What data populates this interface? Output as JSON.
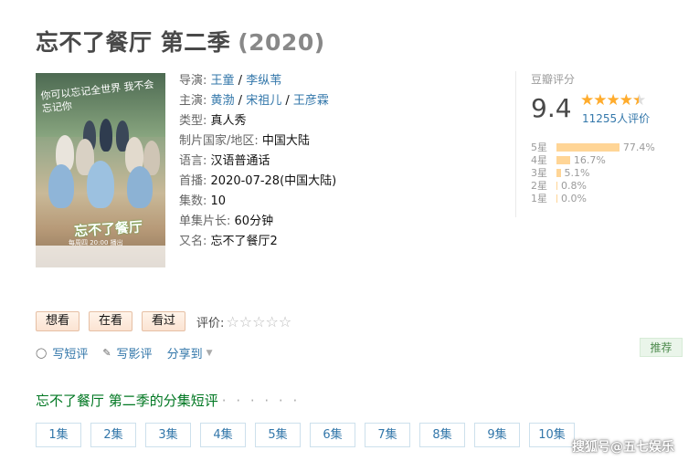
{
  "movie": {
    "title": "忘不了餐厅 第二季",
    "year": "(2020)"
  },
  "poster": {
    "tagline": "你可以忘记全世界 我不会忘记你",
    "logo": "忘不了餐厅",
    "date_text": "每周四 20:00 播出"
  },
  "info": {
    "director_label": "导演:",
    "directors": [
      "王童",
      "李纵苇"
    ],
    "cast_label": "主演:",
    "cast": [
      "黄渤",
      "宋祖儿",
      "王彦霖"
    ],
    "sep": " / ",
    "genre_label": "类型:",
    "genre": "真人秀",
    "country_label": "制片国家/地区:",
    "country": "中国大陆",
    "language_label": "语言:",
    "language": "汉语普通话",
    "premiere_label": "首播:",
    "premiere": "2020-07-28(中国大陆)",
    "episodes_label": "集数:",
    "episodes": "10",
    "runtime_label": "单集片长:",
    "runtime": "60分钟",
    "aka_label": "又名:",
    "aka": "忘不了餐厅2"
  },
  "rating": {
    "label": "豆瓣评分",
    "score": "9.4",
    "count": "11255人评价",
    "stars_value": 4.5,
    "distribution": [
      {
        "label": "5星",
        "percent": "77.4%",
        "value": 77.4
      },
      {
        "label": "4星",
        "percent": "16.7%",
        "value": 16.7
      },
      {
        "label": "3星",
        "percent": "5.1%",
        "value": 5.1
      },
      {
        "label": "2星",
        "percent": "0.8%",
        "value": 0.8
      },
      {
        "label": "1星",
        "percent": "0.0%",
        "value": 0.0
      }
    ]
  },
  "actions": {
    "want": "想看",
    "watching": "在看",
    "watched": "看过",
    "rate_label": "评价:"
  },
  "links": {
    "short_review": "写短评",
    "review": "写影评",
    "share": "分享到"
  },
  "recommend": "推荐",
  "section": {
    "title": "忘不了餐厅 第二季的分集短评",
    "dots": "· · · · · ·"
  },
  "episode_tabs": [
    "1集",
    "2集",
    "3集",
    "4集",
    "5集",
    "6集",
    "7集",
    "8集",
    "9集",
    "10集"
  ],
  "watermark": "搜狐号@五七娱乐",
  "colors": {
    "link": "#3377aa",
    "star": "#ffac2d",
    "section_green": "#007722"
  }
}
